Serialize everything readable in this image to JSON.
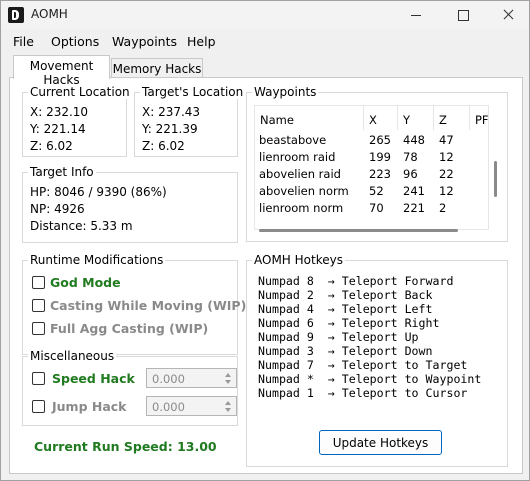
{
  "window": {
    "title": "AOMH"
  },
  "menu": [
    "File",
    "Options",
    "Waypoints",
    "Help"
  ],
  "tabs": [
    {
      "label": "Movement Hacks",
      "active": true
    },
    {
      "label": "Memory Hacks",
      "active": false
    }
  ],
  "current_location": {
    "title": "Current Location",
    "x": "X: 232.10",
    "y": "Y: 221.14",
    "z": "Z: 6.02"
  },
  "target_location": {
    "title": "Target's Location",
    "x": "X: 237.43",
    "y": "Y: 221.39",
    "z": "Z: 6.02"
  },
  "target_info": {
    "title": "Target Info",
    "hp": "HP: 8046 / 9390 (86%)",
    "np": "NP: 4926",
    "distance": "Distance: 5.33 m"
  },
  "waypoints": {
    "title": "Waypoints",
    "columns": [
      "Name",
      "X",
      "Y",
      "Z",
      "PF"
    ],
    "rows": [
      [
        "beastabove",
        "265",
        "448",
        "47"
      ],
      [
        "lienroom raid",
        "199",
        "78",
        "12"
      ],
      [
        "abovelien raid",
        "223",
        "96",
        "22"
      ],
      [
        "abovelien norm",
        "52",
        "241",
        "12"
      ],
      [
        "lienroom norm",
        "70",
        "221",
        "2"
      ]
    ]
  },
  "runtime": {
    "title": "Runtime Modifications",
    "god_mode": "God Mode",
    "casting_moving": "Casting While Moving (WIP)",
    "full_agg": "Full Agg Casting (WIP)"
  },
  "misc": {
    "title": "Miscellaneous",
    "speed_hack": "Speed Hack",
    "speed_value": "0.000",
    "jump_hack": "Jump Hack",
    "jump_value": "0.000"
  },
  "run_speed": "Current Run Speed: 13.00",
  "hotkeys": {
    "title": "AOMH Hotkeys",
    "lines": [
      "Numpad 8  → Teleport Forward",
      "Numpad 2  → Teleport Back",
      "Numpad 4  → Teleport Left",
      "Numpad 6  → Teleport Right",
      "Numpad 9  → Teleport Up",
      "Numpad 3  → Teleport Down",
      "Numpad 7  → Teleport to Target",
      "Numpad *  → Teleport to Waypoint",
      "Numpad 1  → Teleport to Cursor"
    ],
    "button": "Update Hotkeys"
  },
  "colors": {
    "accent": "#0067c0",
    "enabled_label": "#207a20",
    "disabled_label": "#8a8a8a"
  },
  "icons": [
    "app-icon",
    "minimize-icon",
    "maximize-icon",
    "close-icon"
  ]
}
